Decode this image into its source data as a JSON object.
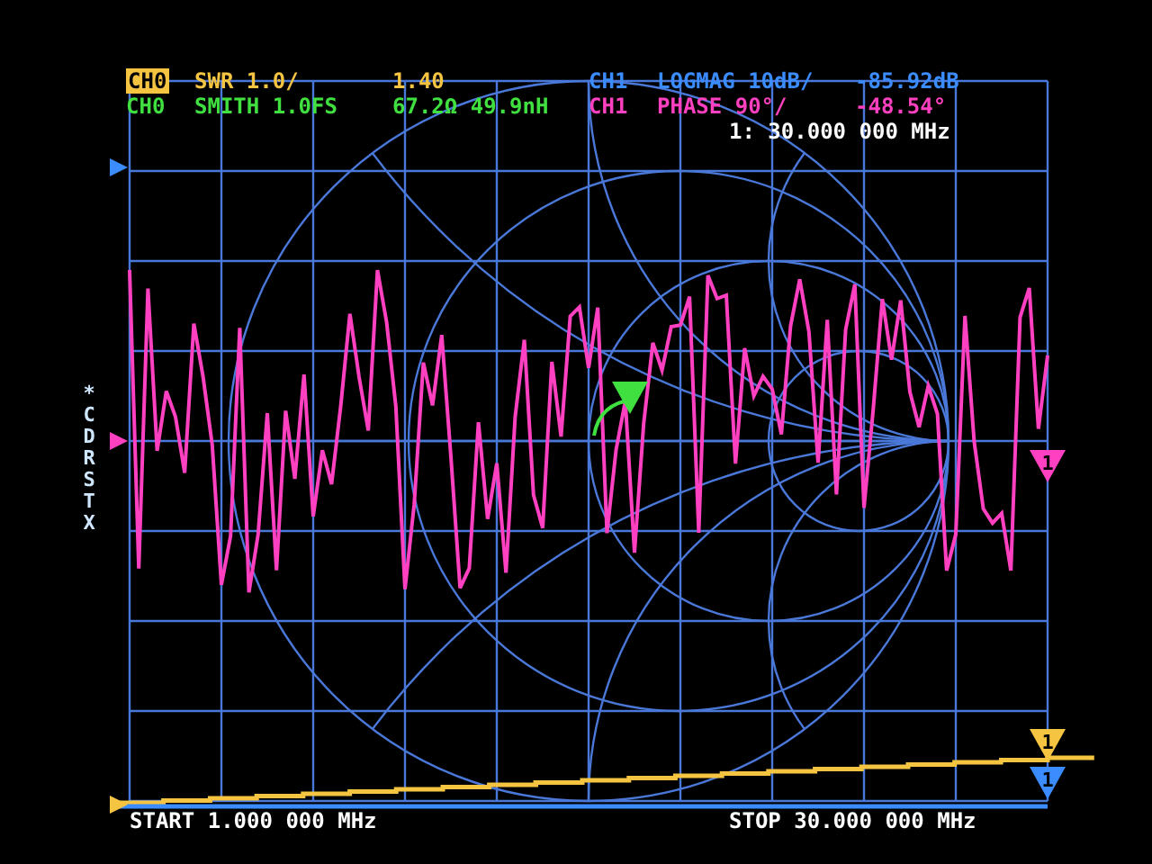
{
  "traces": [
    {
      "channel": "CH0",
      "format": "SWR 1.0/",
      "reading": "1.40",
      "color": "#f5c542",
      "selected": true
    },
    {
      "channel": "CH1",
      "format": "LOGMAG 10dB/",
      "reading": "-85.92dB",
      "color": "#3a8cff",
      "selected": false
    },
    {
      "channel": "CH0",
      "format": "SMITH 1.0FS",
      "reading": "67.2Ω 49.9nH",
      "color": "#40e040",
      "selected": false
    },
    {
      "channel": "CH1",
      "format": "PHASE 90°/",
      "reading": "-48.54°",
      "color": "#ff40c0",
      "selected": false
    }
  ],
  "marker_frequency": "1: 30.000 000 MHz",
  "side_menu": {
    "star": "*",
    "letters": "CDRSTX"
  },
  "markers": [
    {
      "label": "1",
      "color": "#ff40c0"
    },
    {
      "label": "1",
      "color": "#f5c542"
    },
    {
      "label": "1",
      "color": "#3a8cff"
    }
  ],
  "start": "START 1.000 000 MHz",
  "stop": "STOP 30.000 000 MHz"
}
